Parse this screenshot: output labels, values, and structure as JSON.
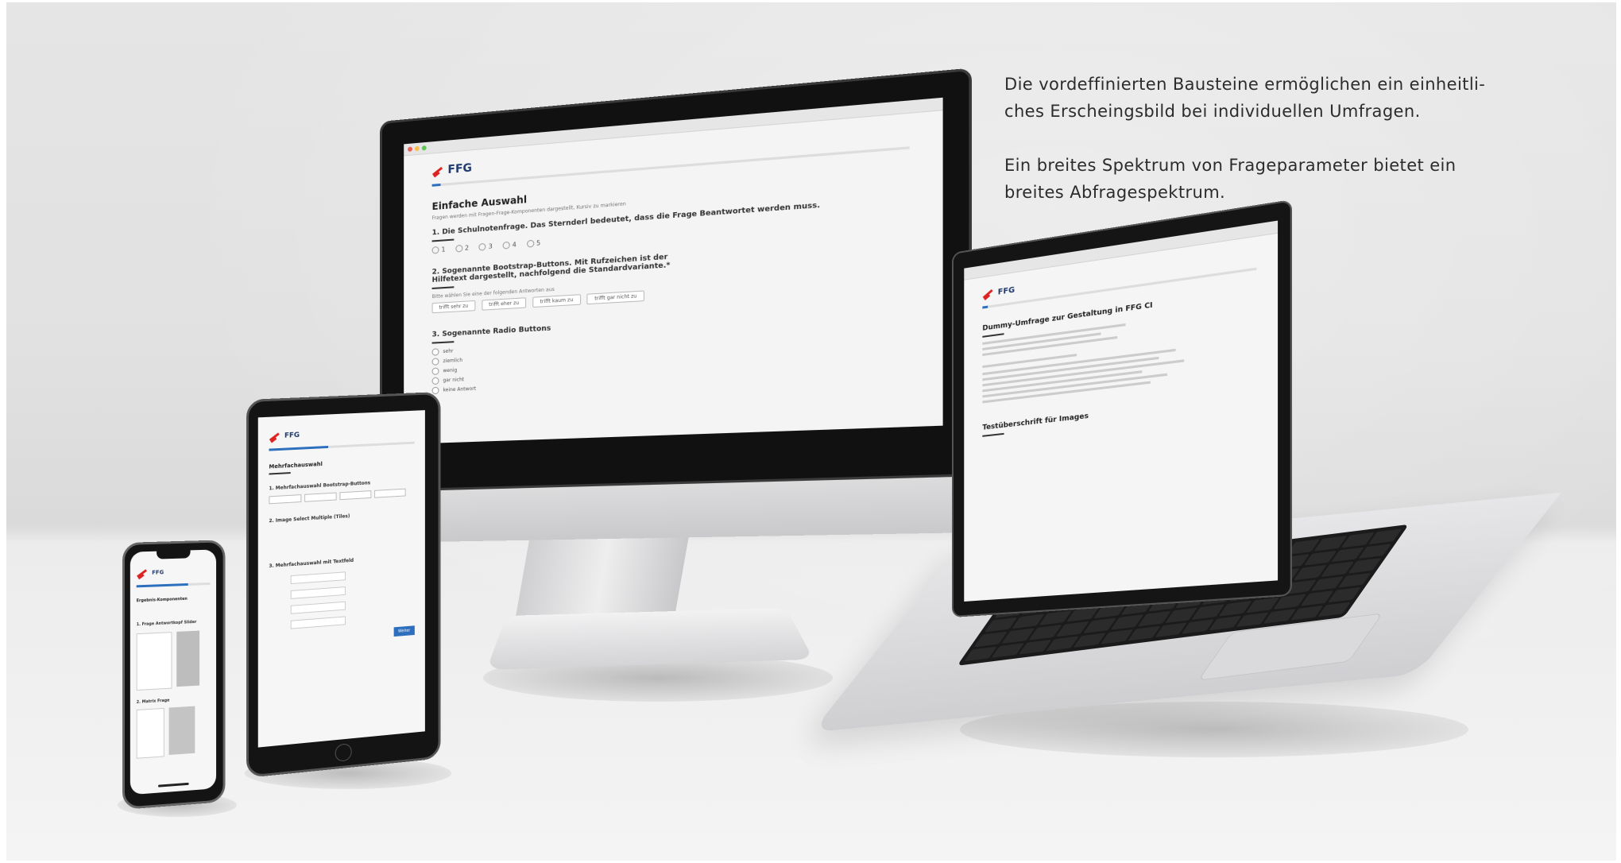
{
  "caption": {
    "paragraph1_line1": "Die vordeffinierten Bausteine ermöglichen ein einheitli-",
    "paragraph1_line2": "ches Erscheingsbild bei individuellen Umfragen.",
    "paragraph2_line1": "Ein breites Spektrum von Frageparameter bietet ein",
    "paragraph2_line2": "breites Abfragespektrum."
  },
  "brand": {
    "logo_text": "FFG",
    "accent": "#d22222",
    "primary": "#2d6fbd"
  },
  "monitor": {
    "section_title": "Einfache Auswahl",
    "intro": "Fragen werden mit Fragen-Frage-Komponenten dargestellt, Kursiv zu markieren",
    "question1": "1. Die Schulnotenfrage. Das Sternderl bedeutet, dass die Frage Beantwortet werden muss.",
    "grades": [
      "1",
      "2",
      "3",
      "4",
      "5"
    ],
    "question2": "2. Sogenannte Bootstrap-Buttons. Mit Rufzeichen ist der Hilfetext dargestellt, nachfolgend die Standardvariante.*",
    "question2_hint": "Bitte wählen Sie eine der folgenden Antworten aus",
    "buttons": [
      "trifft sehr zu",
      "trifft eher zu",
      "trifft kaum zu",
      "trifft gar nicht zu"
    ],
    "question3": "3. Sogenannte Radio Buttons",
    "radios": [
      "sehr",
      "ziemlich",
      "wenig",
      "gar nicht",
      "keine Antwort"
    ]
  },
  "laptop": {
    "title": "Dummy-Umfrage zur Gestaltung in FFG CI",
    "subtitle": "Testüberschrift für Images"
  },
  "tablet": {
    "title": "Mehrfachauswahl",
    "q1": "1. Mehrfachauswahl Bootstrap-Buttons",
    "q2": "2. Image Select Multiple (Tiles)",
    "q3": "3. Mehrfachauswahl mit Textfeld",
    "submit": "Weiter"
  },
  "phone": {
    "title": "Ergebnis-Komponenten",
    "q1": "1. Frage Antwortkopf Slider",
    "q2": "2. Matrix Frage"
  }
}
